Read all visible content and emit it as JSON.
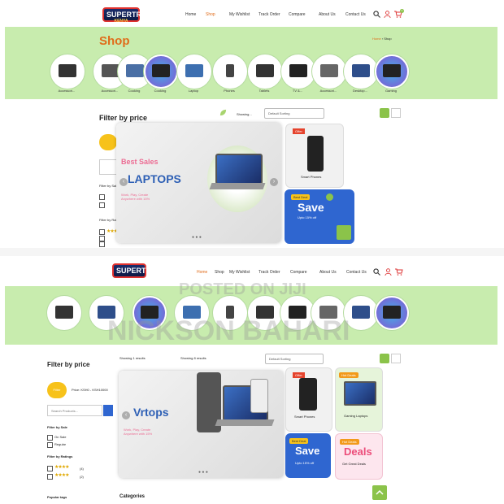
{
  "brand": {
    "name": "SUPERTRADERS",
    "tagline": "KENYA"
  },
  "nav": [
    "Home",
    "Shop",
    "My Wishlist",
    "Track Order",
    "Compare",
    "About Us",
    "Contact Us"
  ],
  "cart_count": "0",
  "shop": {
    "title": "Shop",
    "breadcrumb_home": "Home",
    "breadcrumb_current": "Shop"
  },
  "categories_top": [
    "Accessori...",
    "Accessori...",
    "Cooking",
    "Cooking",
    "Laptop",
    "Phones",
    "Tablets",
    "TV &...",
    "Accessori...",
    "Desktop...",
    "Gaming"
  ],
  "filter": {
    "title_top": "Filter by price",
    "title_bottom": "Filter by price",
    "filter_button": "Filter",
    "price_range": "Price: KSH0 - KSH10000",
    "search_placeholder": "Search Products...",
    "by_sale": "Filter by Sale",
    "on_sale": "On Sale",
    "regular": "Regular",
    "by_ratings": "Filter by Ratings",
    "rating_counts": [
      "(4)",
      "(2)"
    ],
    "related_title": "Popular tags"
  },
  "toolbar": {
    "showing": "Showing...",
    "sort": "Default Sorting",
    "top_link_a": "Showing 1 results",
    "top_link_b": "Showing 8 results"
  },
  "hero": {
    "kicker": "Best Sales",
    "title_top": "LAPTOPS",
    "title_bottom": "Vrtops",
    "subtitle": "Work, Play, Create Anywhere with 15%",
    "button": "Shop Now"
  },
  "promos": {
    "offer_tag": "Offer",
    "offer_caption": "Smart Phones",
    "best_deal_tag": "Best Deal",
    "save": "Save",
    "save_caption": "Upto 15% off",
    "hot_tag": "Hot Deals",
    "gaming_caption": "Gaming Laptops",
    "deals": "Deals",
    "deals_caption": "Get Great Deals"
  },
  "watermark": {
    "line1": "POSTED ON JIJI",
    "line2": "NICKSON BAHARI"
  },
  "footer_heads": {
    "left": "Popular tags",
    "mid": "Categories"
  },
  "colors": {
    "green": "#c8ecae",
    "accent": "#e06c1a",
    "blue": "#2f66d0",
    "pink": "#ec6c93"
  }
}
